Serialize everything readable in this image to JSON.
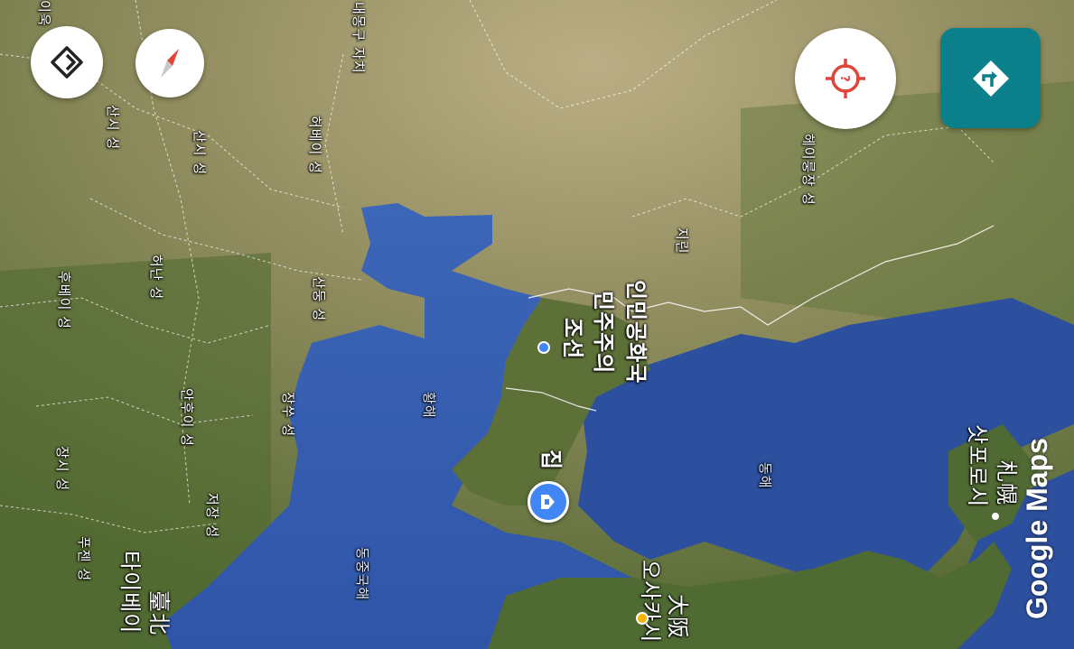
{
  "map": {
    "labels": {
      "naemonggu": "내몽구 자치",
      "inner_top": "이욱",
      "shanxi1": "산시 성",
      "shanxi2": "산시 성",
      "hebei": "허베이 성",
      "heilongjiang": "헤이룽장 성",
      "jilin": "지린",
      "henan": "허난 성",
      "shandong": "산둥 성",
      "hubei": "후베이 성",
      "anhui": "안후이 성",
      "jiangsu": "장쑤 성",
      "jiangxi": "장시 성",
      "zhejiang": "저장 성",
      "fujian": "푸젠 성",
      "taipei_ko": "타이베이",
      "taipei_zh": "臺北",
      "dprk_1": "조선",
      "dprk_2": "민주주의",
      "dprk_3": "인민공화국",
      "yellow_sea": "황해",
      "east_sea": "동해",
      "east_china_sea": "동중국해",
      "home": "집",
      "osaka_ko": "오사카시",
      "osaka_zh": "大阪",
      "sapporo_ko": "삿포로시",
      "sapporo_zh": "札幌"
    },
    "watermark": "Google Maps"
  },
  "controls": {
    "directions_icon": "directions-diamond-icon",
    "compass_icon": "compass-icon",
    "locate_icon": "locate-crosshair-icon",
    "navigate_icon": "turn-direction-icon"
  },
  "colors": {
    "accent_teal": "#0b7f8a",
    "locate_red": "#e0463a",
    "home_blue": "#4285f4",
    "location_dot": "#4285f4",
    "osaka_dot": "#f5b400"
  }
}
